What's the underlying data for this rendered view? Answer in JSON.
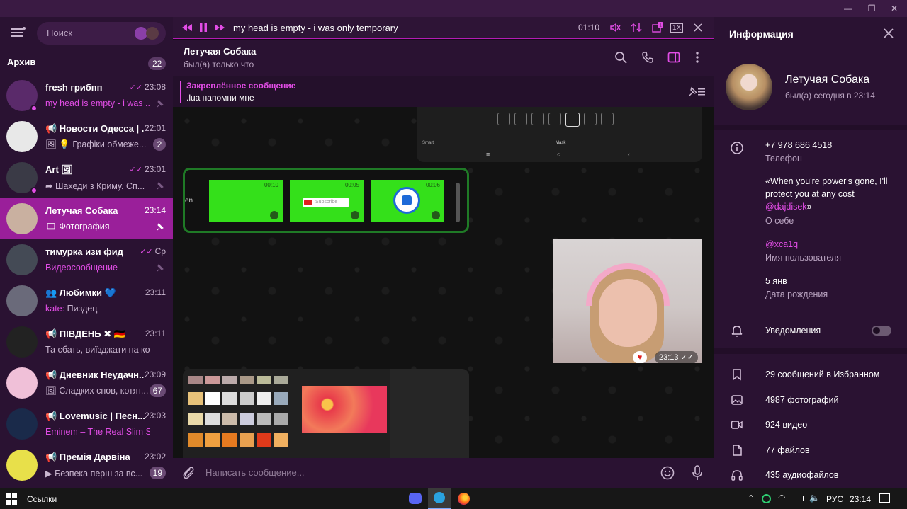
{
  "sidebar": {
    "search_placeholder": "Поиск",
    "archive_label": "Архив",
    "archive_count": "22",
    "chats": [
      {
        "name": "fresh грибпп",
        "time": "23:08",
        "preview": "my head is empty - i was ...",
        "preview_highlight": true,
        "read": true
      },
      {
        "name": "📢 Новости Одесса | ...",
        "time": "22:01",
        "preview": "🖼 💡 Графіки обмеже...",
        "badge": "2"
      },
      {
        "name": "Art 🖼",
        "time": "23:01",
        "preview": "➦ Шахеди з Криму. Сп...",
        "read": true
      },
      {
        "name": "Летучая Собака",
        "time": "23:14",
        "preview": "🎞 Фотография",
        "active": true
      },
      {
        "name": "тимурка изи фид",
        "time": "Ср",
        "preview": "Видеосообщение",
        "preview_highlight": true,
        "read": true
      },
      {
        "name": "👥 Любимки 💙",
        "time": "23:11",
        "preview_sender": "kate:",
        "preview": " Пиздец"
      },
      {
        "name": "📢 ПІВДЕНЬ ✖ 🇩🇪",
        "time": "23:11",
        "preview": "Та єбать, виїзджати на коме..."
      },
      {
        "name": "📢 Дневник Неудачн...",
        "time": "23:09",
        "preview": "🖼 Сладких снов, котят...",
        "badge": "67"
      },
      {
        "name": "📢 Lovemusic | Песн...",
        "time": "23:03",
        "preview": "Eminem – The Real Slim Shad...",
        "preview_highlight": true
      },
      {
        "name": "📢 Премія Дарвіна",
        "time": "23:02",
        "preview": "▶ Безпека перш за вс...",
        "badge": "19"
      }
    ]
  },
  "player": {
    "track": "my head is empty - i was only temporary",
    "time": "01:10",
    "speed": "1X",
    "playlist_badge": "1"
  },
  "chat": {
    "name": "Летучая Собака",
    "status": "был(а) только что",
    "pinned_title": "Закреплённое сообщение",
    "pinned_text": ".lua напомни мне",
    "message_time": "23:13",
    "video_durations": [
      "00:10",
      "00:05",
      "00:06"
    ],
    "subscribe_label": "Subscribe",
    "mask_label": "Mask",
    "smart_label": "Smart",
    "en_label": "en",
    "composer_placeholder": "Написать сообщение..."
  },
  "info": {
    "title": "Информация",
    "name": "Летучая Собака",
    "status": "был(а) сегодня в 23:14",
    "phone": "+7 978 686 4518",
    "phone_label": "Телефон",
    "bio": "«When you're power's gone, I'll protect you at any cost",
    "bio_link": "@dajdisek",
    "bio_end": "»",
    "bio_label": "О себе",
    "username": "@xca1q",
    "username_label": "Имя пользователя",
    "birthday": "5 янв",
    "birthday_label": "Дата рождения",
    "notifications": "Уведомления",
    "stats": [
      "29 сообщений в Избранном",
      "4987 фотографий",
      "924 видео",
      "77 файлов",
      "435 аудиофайлов"
    ]
  },
  "taskbar": {
    "links": "Ссылки",
    "lang": "РУС",
    "time": "23:14"
  },
  "colors": {
    "accent": "#e24de6",
    "active_chat": "#9a1f9a",
    "panel": "#2a1232"
  }
}
